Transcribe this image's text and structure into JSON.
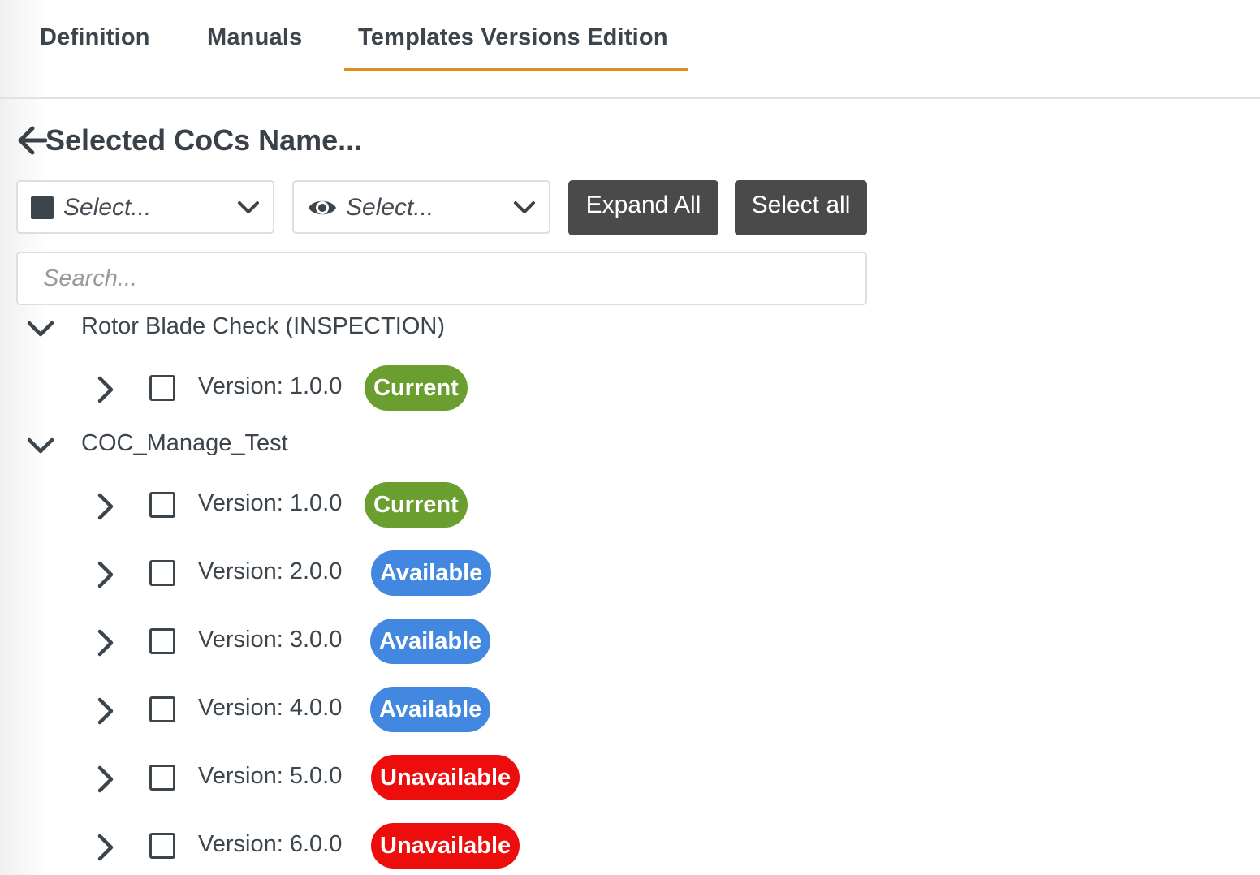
{
  "tabs": [
    {
      "label": "Definition",
      "active": false
    },
    {
      "label": "Manuals",
      "active": false
    },
    {
      "label": "Templates Versions Edition",
      "active": true
    }
  ],
  "accent_color": "#e0901a",
  "header": {
    "title": "Selected CoCs Name...",
    "back_icon": "arrow-left-icon"
  },
  "filters": {
    "status_select": {
      "value": "Select...",
      "icon": "square-icon"
    },
    "visibility_select": {
      "value": "Select...",
      "icon": "eye-icon"
    }
  },
  "buttons": {
    "expand_all": "Expand All",
    "select_all": "Select all"
  },
  "search": {
    "placeholder": "Search...",
    "value": ""
  },
  "badge_colors": {
    "Current": "#6a9e2e",
    "Available": "#4287e0",
    "Unavailable": "#ee0d0d"
  },
  "tree": [
    {
      "name": "Rotor Blade Check (INSPECTION)",
      "expanded": true,
      "versions": [
        {
          "label": "Version: 1.0.0",
          "status": "Current",
          "checked": false
        }
      ]
    },
    {
      "name": "COC_Manage_Test",
      "expanded": true,
      "versions": [
        {
          "label": "Version: 1.0.0",
          "status": "Current",
          "checked": false
        },
        {
          "label": "Version: 2.0.0",
          "status": "Available",
          "checked": false
        },
        {
          "label": "Version: 3.0.0",
          "status": "Available",
          "checked": false
        },
        {
          "label": "Version: 4.0.0",
          "status": "Available",
          "checked": false
        },
        {
          "label": "Version: 5.0.0",
          "status": "Unavailable",
          "checked": false
        },
        {
          "label": "Version: 6.0.0",
          "status": "Unavailable",
          "checked": false
        }
      ]
    }
  ]
}
